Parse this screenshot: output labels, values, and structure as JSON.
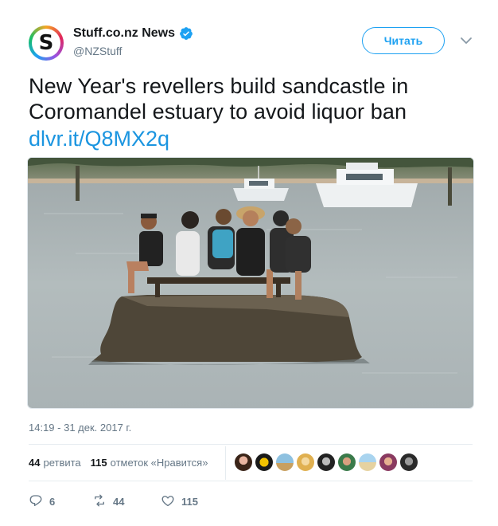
{
  "account": {
    "display_name": "Stuff.co.nz News",
    "handle": "@NZStuff",
    "avatar_letter": "S",
    "verified_color": "#1da1f2"
  },
  "follow_button": {
    "label": "Читать"
  },
  "tweet": {
    "text": "New Year's revellers build sandcastle in Coromandel estuary to avoid liquor ban",
    "link": "dlvr.it/Q8MX2q",
    "timestamp": "14:19 - 31 дек. 2017 г."
  },
  "stats": {
    "retweets_count": "44",
    "retweets_label": "ретвита",
    "likes_count": "115",
    "likes_label": "отметок «Нравится»"
  },
  "actions": {
    "reply_count": "6",
    "retweet_count": "44",
    "like_count": "115"
  },
  "colors": {
    "accent": "#1da1f2",
    "link": "#1b95e0",
    "muted": "#657786"
  }
}
